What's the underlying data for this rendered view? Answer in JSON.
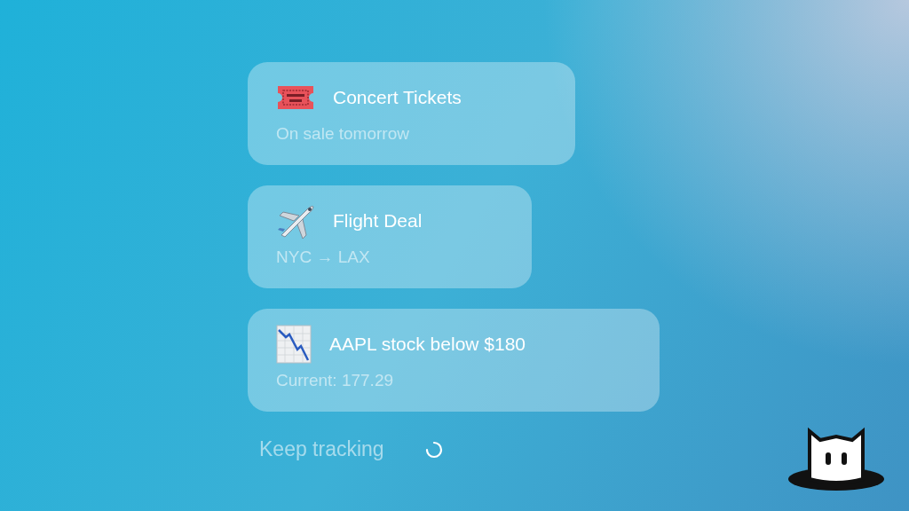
{
  "alerts": [
    {
      "kind": "ticket",
      "title": "Concert Tickets",
      "subtitle": "On sale tomorrow"
    },
    {
      "kind": "plane",
      "title": "Flight Deal",
      "subtitle": "NYC → LAX"
    },
    {
      "kind": "chart",
      "title": "AAPL stock below $180",
      "subtitle": "Current: 177.29"
    }
  ],
  "footer": {
    "label": "Keep tracking"
  }
}
